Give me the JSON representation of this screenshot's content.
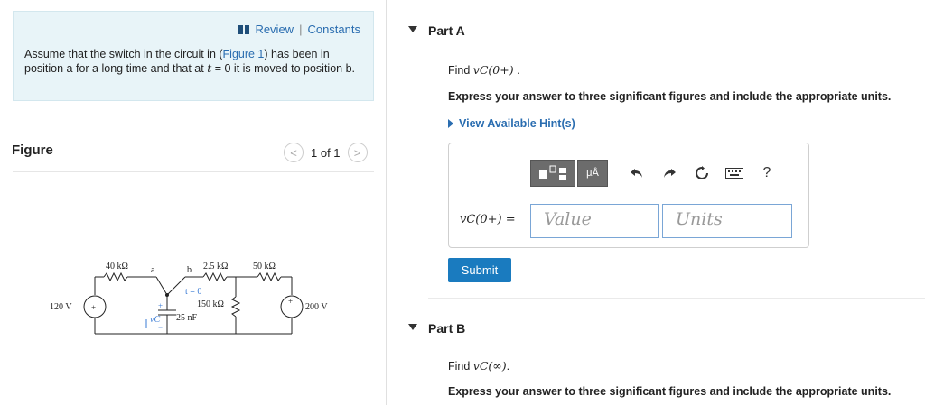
{
  "header": {
    "review_label": "Review",
    "separator": "|",
    "constants_label": "Constants"
  },
  "intro": {
    "text_before": "Assume that the switch in the circuit in (",
    "figure_link": "Figure 1",
    "text_mid": ") has been in position a for a long time and that at ",
    "t_symbol": "t",
    "text_after": " = 0 it is moved to position b."
  },
  "figure": {
    "label": "Figure",
    "pager_prev": "<",
    "pager_text": "1 of 1",
    "pager_next": ">"
  },
  "circuit": {
    "r1": "40 kΩ",
    "r2": "2.5 kΩ",
    "r3": "50 kΩ",
    "r4": "150 kΩ",
    "cap": "25 nF",
    "v1": "120 V",
    "v2": "200 V",
    "node_a": "a",
    "node_b": "b",
    "switch_time": "t = 0",
    "vc_label": "vC",
    "plus": "+",
    "minus": "−"
  },
  "partA": {
    "title": "Part A",
    "find_prefix": "Find ",
    "find_expr": "vC(0+)",
    "find_suffix": " .",
    "instruction": "Express your answer to three significant figures and include the appropriate units.",
    "hint_label": "View Available Hint(s)",
    "eq_label": "vC(0+) =",
    "value_placeholder": "Value",
    "units_placeholder": "Units",
    "submit_label": "Submit",
    "toolbar": {
      "templates_icon": "template-icon",
      "units_icon_text": "μÅ",
      "undo_icon": "undo-icon",
      "redo_icon": "redo-icon",
      "reset_icon": "reset-icon",
      "keyboard_icon": "keyboard-icon",
      "help_label": "?"
    }
  },
  "partB": {
    "title": "Part B",
    "find_prefix": "Find ",
    "find_expr": "vC(∞)",
    "find_suffix": ".",
    "instruction": "Express your answer to three significant figures and include the appropriate units."
  }
}
